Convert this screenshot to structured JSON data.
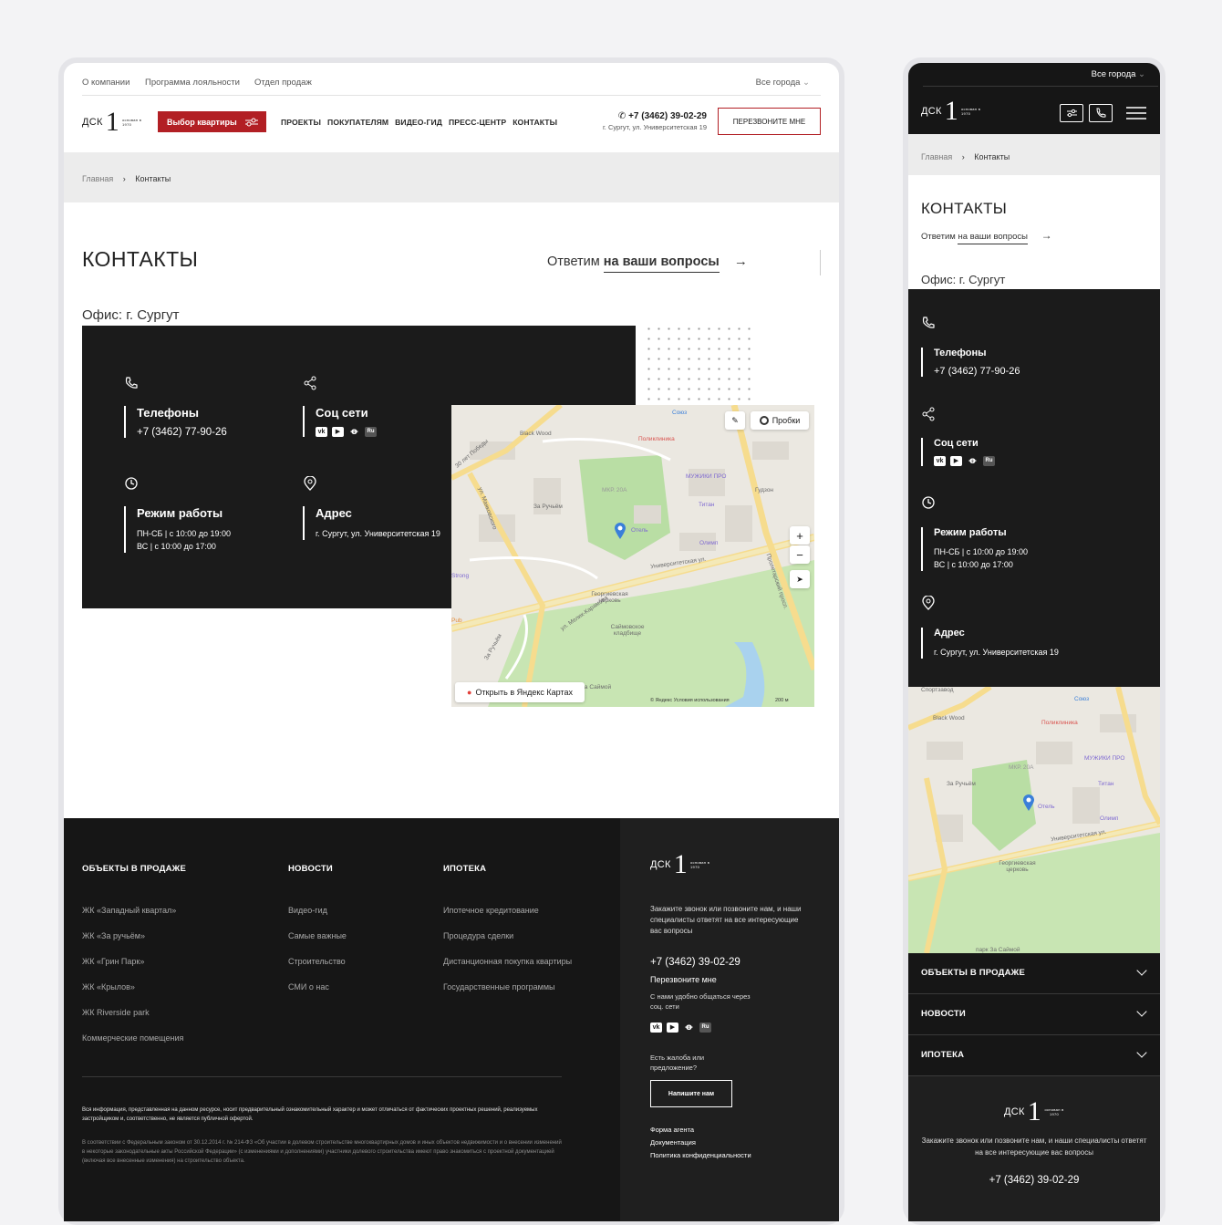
{
  "desktop": {
    "topnav": {
      "items": [
        "О компании",
        "Программа лояльности",
        "Отдел продаж"
      ],
      "city": "Все города"
    },
    "logo": {
      "text": "ДСК",
      "tagline": "основан в 1970"
    },
    "choose_btn": "Выбор квартиры",
    "mainnav": [
      "ПРОЕКТЫ",
      "ПОКУПАТЕЛЯМ",
      "ВИДЕО-ГИД",
      "ПРЕСС-ЦЕНТР",
      "КОНТАКТЫ"
    ],
    "phone": "+7 (3462) 39-02-29",
    "address_short": "г. Сургут, ул. Университетская 19",
    "call_btn": "ПЕРЕЗВОНИТЕ МНЕ",
    "breadcrumb": {
      "home": "Главная",
      "sep": "›",
      "current": "Контакты"
    },
    "title": "КОНТАКТЫ",
    "ask": {
      "pre": "Ответим",
      "link": "на ваши вопросы",
      "arrow": "→"
    },
    "office": "Офис: г. Сургут",
    "phones": {
      "title": "Телефоны",
      "value": "+7 (3462) 77-90-26"
    },
    "social": {
      "title": "Соц сети",
      "icons": [
        "vk-icon",
        "youtube-icon",
        "ok-icon",
        "mailru-icon"
      ]
    },
    "hours": {
      "title": "Режим работы",
      "line1": "ПН-СБ | с 10:00 до 19:00",
      "line2": "ВС | с 10:00 до 17:00"
    },
    "address": {
      "title": "Адрес",
      "value": "г. Сургут, ул. Университетская 19"
    },
    "map": {
      "traffic": "Пробки",
      "open": "Открыть в Яндекс Картах",
      "copyright": "© Яндекс   Условия использования",
      "scale": "200 м",
      "labels": [
        "Black Wood",
        "Поликлиника",
        "МУЖИКИ ПРО",
        "МКР. 20А",
        "Титан",
        "За Ручьём",
        "Отель",
        "Олимп",
        "Университетская ул.",
        "Георгиевская церковь",
        "Саймовское кладбище",
        "ул. Маяковского",
        "30 лет Победы",
        "Союз",
        "Гудзон",
        "Пролетарский просп.",
        "Strong",
        "Pub",
        "За Ручьём",
        "За Саймой",
        "ул. Мелик-Карамова"
      ]
    },
    "footer": {
      "cols": [
        {
          "title": "ОБЪЕКТЫ В ПРОДАЖЕ",
          "items": [
            "ЖК «Западный квартал»",
            "ЖК «За ручьём»",
            "ЖК «Грин Парк»",
            "ЖК «Крылов»",
            "ЖК Riverside park",
            "Коммерческие помещения"
          ]
        },
        {
          "title": "НОВОСТИ",
          "items": [
            "Видео-гид",
            "Самые важные",
            "Строительство",
            "СМИ о нас"
          ]
        },
        {
          "title": "ИПОТЕКА",
          "items": [
            "Ипотечное кредитование",
            "Процедура сделки",
            "Дистанционная покупка квартиры",
            "Государственные программы"
          ]
        }
      ],
      "legal1": "Вся информация, представленная на данном ресурсе, носит предварительный ознакомительный характер и может отличаться от фактических проектных решений, реализуемых застройщиком и, соответственно, не является публичной офертой.",
      "legal2": "В соответствии с Федеральным законом от 30.12.2014 г. № 214-ФЗ «Об участии в долевом строительстве многоквартирных домов и иных объектов недвижимости и о внесении изменений в некоторые законодательные акты Российской Федерации» (с изменениями и дополнениями) участники долевого строительства имеют право знакомиться с проектной документацией (включая все внесенные изменения) на строительство объекта.",
      "right": {
        "text": "Закажите звонок или позвоните нам, и наши специалисты ответят на все интересующие вас вопросы",
        "phone": "+7 (3462) 39-02-29",
        "callback": "Перезвоните мне",
        "social_text": "С нами удобно общаться через соц. сети",
        "complaint": "Есть жалоба или предложение?",
        "write_btn": "Напишите нам",
        "links": [
          "Форма агента",
          "Документация",
          "Политика конфиденциальности"
        ]
      }
    }
  },
  "mobile": {
    "city": "Все города",
    "breadcrumb": {
      "home": "Главная",
      "sep": "›",
      "current": "Контакты"
    },
    "title": "КОНТАКТЫ",
    "ask_pre": "Ответим",
    "ask_link": "на ваши вопросы",
    "office": "Офис: г. Сургут",
    "phones_title": "Телефоны",
    "phone": "+7 (3462) 77-90-26",
    "social_title": "Соц сети",
    "hours_title": "Режим работы",
    "hours1": "ПН-СБ | с 10:00 до 19:00",
    "hours2": "ВС | с 10:00 до 17:00",
    "address_title": "Адрес",
    "address": "г. Сургут, ул. Университетская 19",
    "accordions": [
      "ОБЪЕКТЫ В ПРОДАЖЕ",
      "НОВОСТИ",
      "ИПОТЕКА"
    ],
    "footer_text": "Закажите звонок или позвоните нам, и наши специалисты ответят на все интересующие вас вопросы",
    "footer_phone": "+7 (3462) 39-02-29",
    "map_labels": [
      "Спортзавод",
      "Союз",
      "Black Wood",
      "Поликлиника",
      "МУЖИКИ ПРО",
      "МКР. 20А",
      "За Ручьём",
      "Титан",
      "Отель",
      "Олимп",
      "Университетская ул.",
      "Георгиевская церковь",
      "парк За Саймой"
    ]
  },
  "colors": {
    "accent": "#b21f24",
    "dark": "#161616",
    "grey": "#ececec"
  }
}
